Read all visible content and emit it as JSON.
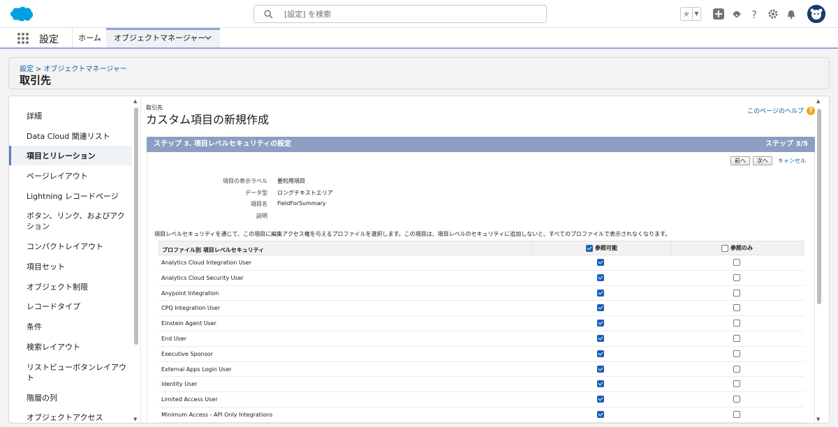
{
  "header": {
    "search_placeholder": "[設定] を検索",
    "icons": [
      "favorites-star-icon",
      "add-icon",
      "trailhead-icon",
      "help-icon",
      "setup-gear-icon",
      "notifications-bell-icon",
      "user-avatar-icon"
    ]
  },
  "nav": {
    "app_name": "設定",
    "tabs": [
      {
        "label": "ホーム"
      },
      {
        "label": "オブジェクトマネージャー"
      }
    ]
  },
  "page_header": {
    "breadcrumb": [
      "設定",
      "オブジェクトマネージャー"
    ],
    "breadcrumb_sep": ">",
    "title": "取引先"
  },
  "sidebar": {
    "items": [
      {
        "label": "詳細"
      },
      {
        "label": "Data Cloud 関連リスト"
      },
      {
        "label": "項目とリレーション"
      },
      {
        "label": "ページレイアウト"
      },
      {
        "label": "Lightning レコードページ"
      },
      {
        "label": "ボタン、リンク、およびアクション"
      },
      {
        "label": "コンパクトレイアウト"
      },
      {
        "label": "項目セット"
      },
      {
        "label": "オブジェクト制限"
      },
      {
        "label": "レコードタイプ"
      },
      {
        "label": "条件"
      },
      {
        "label": "検索レイアウト"
      },
      {
        "label": "リストビューボタンレイアウト"
      },
      {
        "label": "階層の列"
      },
      {
        "label": "オブジェクトアクセス"
      }
    ],
    "active_index": 2
  },
  "content": {
    "kicker": "取引先",
    "title": "カスタム項目の新規作成",
    "help_link": "このページのヘルプ",
    "step_title": "ステップ 3. 項目レベルセキュリティの設定",
    "step_count": "ステップ 3/5",
    "buttons": {
      "prev": "前へ",
      "next": "次へ",
      "cancel": "キャンセル"
    },
    "fields": [
      {
        "label": "項目の表示ラベル",
        "value": "要約用項目"
      },
      {
        "label": "データ型",
        "value": "ロングテキストエリア"
      },
      {
        "label": "項目名",
        "value": "FieldForSummary"
      },
      {
        "label": "説明",
        "value": ""
      }
    ],
    "note": "項目レベルセキュリティを通じて、この項目に編集アクセス権を与えるプロファイルを選択します。この項目は、項目レベルのセキュリティに追加しないと、すべてのプロファイルで表示されなくなります。",
    "table": {
      "headers": {
        "profile": "プロファイル別 項目レベルセキュリティ",
        "visible": "参照可能",
        "readonly": "参照のみ"
      },
      "header_checked": {
        "visible": true,
        "readonly": false
      },
      "rows": [
        {
          "profile": "Analytics Cloud Integration User",
          "visible": true,
          "readonly": false
        },
        {
          "profile": "Analytics Cloud Security User",
          "visible": true,
          "readonly": false
        },
        {
          "profile": "Anypoint Integration",
          "visible": true,
          "readonly": false
        },
        {
          "profile": "CPQ Integration User",
          "visible": true,
          "readonly": false
        },
        {
          "profile": "Einstein Agent User",
          "visible": true,
          "readonly": false
        },
        {
          "profile": "End User",
          "visible": true,
          "readonly": false
        },
        {
          "profile": "Executive Sponsor",
          "visible": true,
          "readonly": false
        },
        {
          "profile": "External Apps Login User",
          "visible": true,
          "readonly": false
        },
        {
          "profile": "Identity User",
          "visible": true,
          "readonly": false
        },
        {
          "profile": "Limited Access User",
          "visible": true,
          "readonly": false
        },
        {
          "profile": "Minimum Access - API Only Integrations",
          "visible": true,
          "readonly": false
        }
      ]
    }
  },
  "colors": {
    "brand": "#00a1e0",
    "accent": "#8d9ec3",
    "link": "#0b5cab",
    "checkbox": "#1a5fb4"
  }
}
